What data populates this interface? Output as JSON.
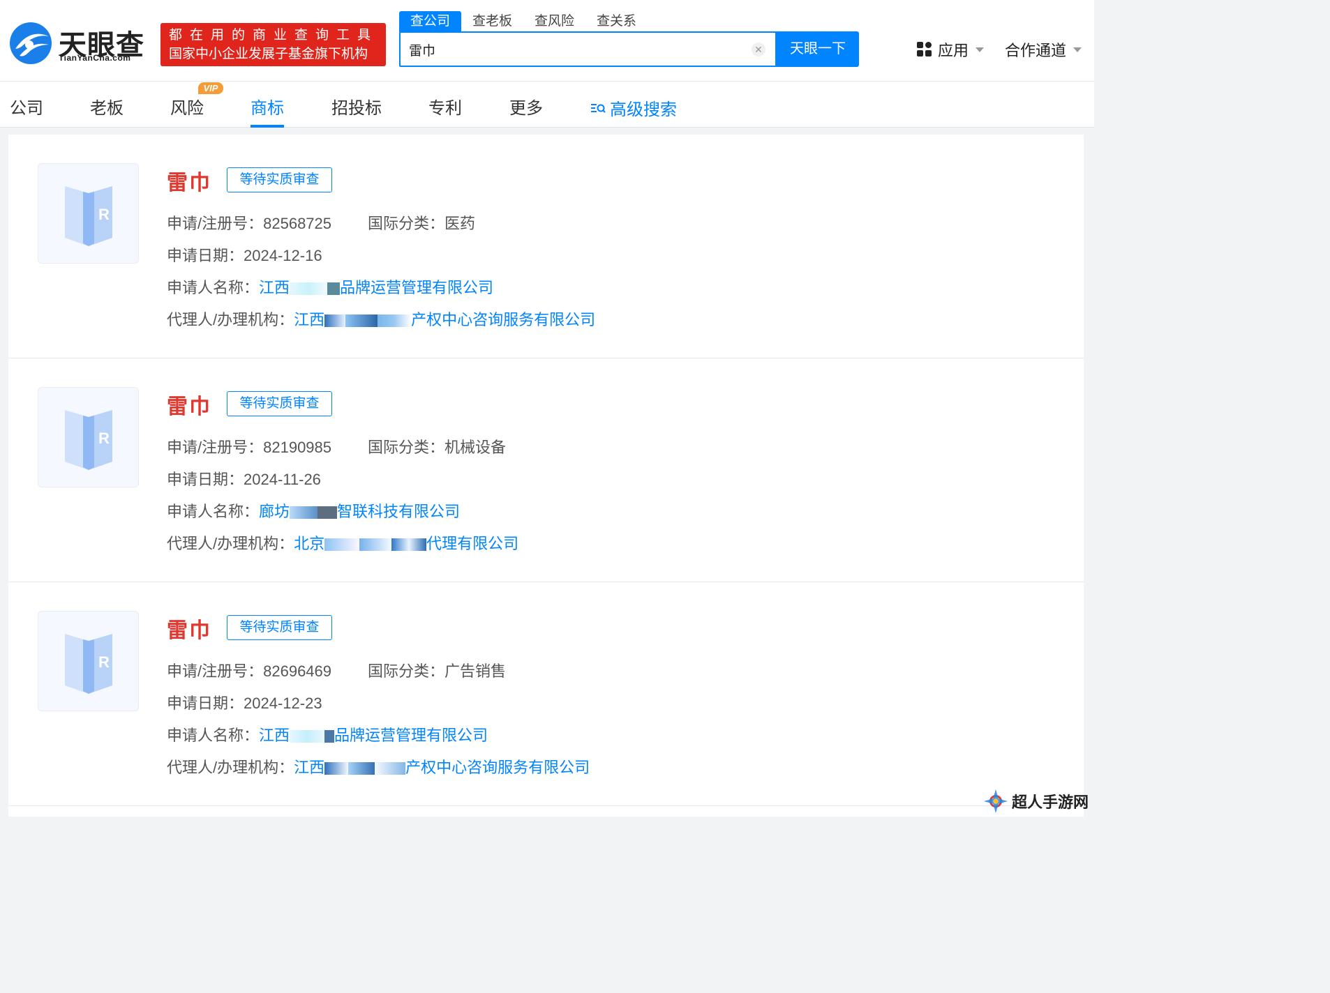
{
  "header": {
    "logo_text": "天眼查",
    "logo_sub": "TianYanCha.com",
    "slogan_line1": "都在用的商业查询工具",
    "slogan_line2": "国家中小企业发展子基金旗下机构",
    "search_tabs": [
      "查公司",
      "查老板",
      "查风险",
      "查关系"
    ],
    "search_value": "雷巾",
    "search_button": "天眼一下",
    "apps_label": "应用",
    "partner_label": "合作通道"
  },
  "nav": {
    "items": [
      "公司",
      "老板",
      "风险",
      "商标",
      "招投标",
      "专利",
      "更多"
    ],
    "vip_badge": "VIP",
    "advanced_search": "高级搜索"
  },
  "labels": {
    "reg_no": "申请/注册号：",
    "intl_class": "国际分类：",
    "apply_date": "申请日期：",
    "applicant": "申请人名称：",
    "agent": "代理人/办理机构："
  },
  "results": [
    {
      "name": "雷巾",
      "status": "等待实质审查",
      "reg_no": "82568725",
      "intl_class": "医药",
      "apply_date": "2024-12-16",
      "applicant_prefix": "江西",
      "applicant_suffix": "品牌运营管理有限公司",
      "agent_prefix": "江西",
      "agent_suffix": "产权中心咨询服务有限公司"
    },
    {
      "name": "雷巾",
      "status": "等待实质审查",
      "reg_no": "82190985",
      "intl_class": "机械设备",
      "apply_date": "2024-11-26",
      "applicant_prefix": "廊坊",
      "applicant_suffix": "智联科技有限公司",
      "agent_prefix": "北京",
      "agent_suffix": "代理有限公司"
    },
    {
      "name": "雷巾",
      "status": "等待实质审查",
      "reg_no": "82696469",
      "intl_class": "广告销售",
      "apply_date": "2024-12-23",
      "applicant_prefix": "江西",
      "applicant_suffix": "品牌运营管理有限公司",
      "agent_prefix": "江西",
      "agent_suffix": "产权中心咨询服务有限公司"
    }
  ],
  "watermark": "超人手游网",
  "colors": {
    "accent": "#0084ff",
    "brand_red": "#e0251c",
    "trademark_red": "#e0382f",
    "vip_orange": "#f39c38"
  }
}
